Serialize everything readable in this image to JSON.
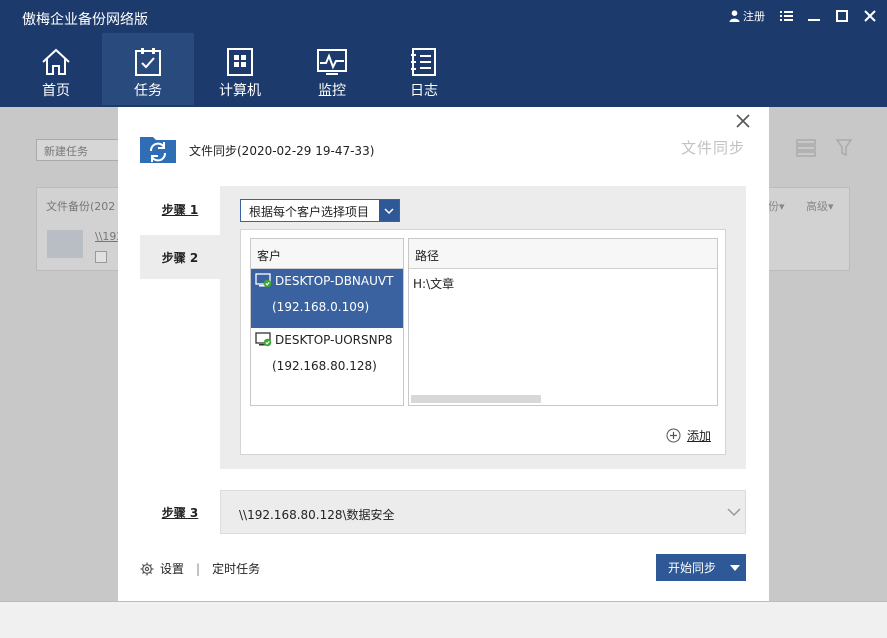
{
  "app": {
    "title": "傲梅企业备份网络版",
    "register_label": "注册"
  },
  "nav": {
    "items": [
      {
        "label": "首页",
        "icon": "home-icon"
      },
      {
        "label": "任务",
        "icon": "task-icon",
        "active": true
      },
      {
        "label": "计算机",
        "icon": "computer-icon"
      },
      {
        "label": "监控",
        "icon": "monitor-icon"
      },
      {
        "label": "日志",
        "icon": "log-icon"
      }
    ]
  },
  "background": {
    "new_task_label": "新建任务",
    "card_title": "文件备份(202",
    "card_link": "\\\\192",
    "card_check_text": "试",
    "col_backup": "份▾",
    "col_advanced": "高级▾"
  },
  "dialog": {
    "title": "文件同步(2020-02-29 19-47-33)",
    "watermark": "文件同步",
    "step1_label": "步骤 1",
    "step2_label": "步骤 2",
    "step3_label": "步骤 3",
    "select_value": "根据每个客户选择项目",
    "client_header": "客户",
    "path_header": "路径",
    "clients": [
      {
        "name": "DESKTOP-DBNAUVT",
        "ip": "(192.168.0.109)",
        "selected": true
      },
      {
        "name": "DESKTOP-UORSNP8",
        "ip": "(192.168.80.128)",
        "selected": false
      }
    ],
    "paths": [
      "H:\\文章"
    ],
    "add_label": "添加",
    "destination": "\\\\192.168.80.128\\数据安全",
    "settings_label": "设置",
    "schedule_label": "定时任务",
    "start_label": "开始同步"
  },
  "colors": {
    "header_bg": "#1c3a6b",
    "accent": "#2f5896",
    "selected_row": "#3a62a0",
    "status_ok": "#3aaa35"
  }
}
